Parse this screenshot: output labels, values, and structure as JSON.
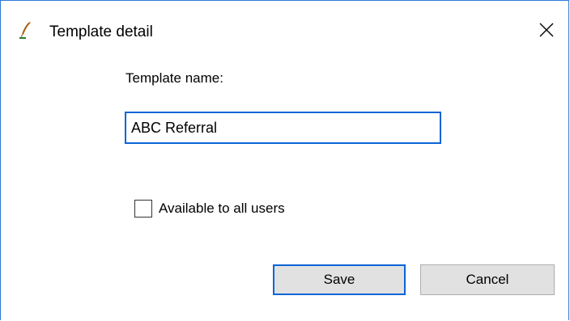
{
  "window": {
    "title": "Template detail",
    "app_icon": "quill-pen-icon",
    "close_icon": "close-icon",
    "close_glyph": "✕"
  },
  "form": {
    "template_name_label": "Template name:",
    "template_name_value": "ABC Referral",
    "available_label": "Available to all users",
    "available_checked": false
  },
  "buttons": {
    "save_label": "Save",
    "cancel_label": "Cancel"
  },
  "colors": {
    "accent": "#0a64d6",
    "window_border": "#2b79d5",
    "button_face": "#e1e1e1"
  }
}
